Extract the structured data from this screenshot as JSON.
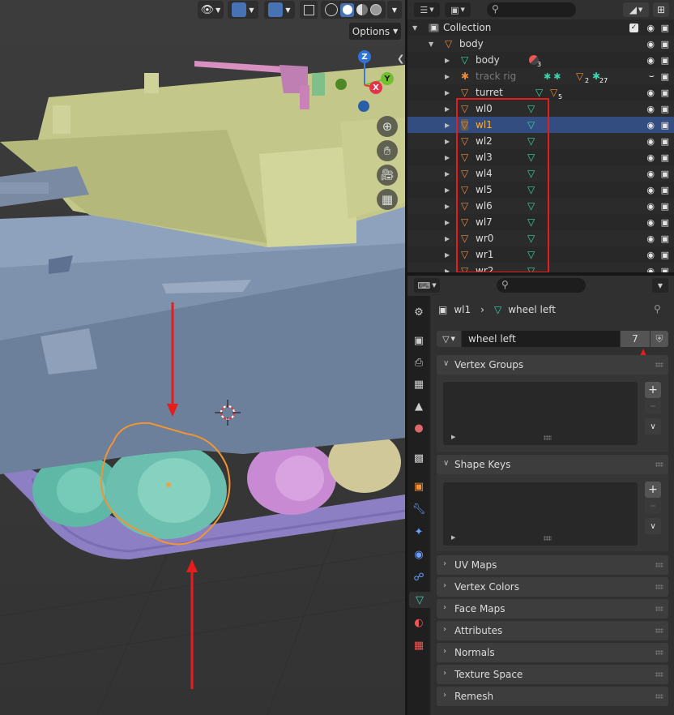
{
  "viewport": {
    "options_label": "Options",
    "gizmo": {
      "z": "Z",
      "y": "Y",
      "x": "X"
    }
  },
  "outliner": {
    "rows": [
      {
        "name": "Collection",
        "kind": "collection"
      },
      {
        "name": "body",
        "kind": "object"
      },
      {
        "name": "body",
        "kind": "mesh",
        "badge": "3"
      },
      {
        "name": "track rig",
        "kind": "armature",
        "badges": [
          "2",
          "27"
        ]
      },
      {
        "name": "turret",
        "kind": "object",
        "badge": "5"
      },
      {
        "name": "wl0",
        "kind": "object"
      },
      {
        "name": "wl1",
        "kind": "object"
      },
      {
        "name": "wl2",
        "kind": "object"
      },
      {
        "name": "wl3",
        "kind": "object"
      },
      {
        "name": "wl4",
        "kind": "object"
      },
      {
        "name": "wl5",
        "kind": "object"
      },
      {
        "name": "wl6",
        "kind": "object"
      },
      {
        "name": "wl7",
        "kind": "object"
      },
      {
        "name": "wr0",
        "kind": "object"
      },
      {
        "name": "wr1",
        "kind": "object"
      },
      {
        "name": "wr2",
        "kind": "object"
      }
    ]
  },
  "properties": {
    "breadcrumb": {
      "object": "wl1",
      "data": "wheel left"
    },
    "datablock": {
      "name": "wheel left",
      "users": "7"
    },
    "panels": {
      "vertex_groups": "Vertex Groups",
      "shape_keys": "Shape Keys",
      "uv_maps": "UV Maps",
      "vertex_colors": "Vertex Colors",
      "face_maps": "Face Maps",
      "attributes": "Attributes",
      "normals": "Normals",
      "texture_space": "Texture Space",
      "remesh": "Remesh"
    }
  },
  "colors": {
    "selection_active": "#ffaf29",
    "annotation": "#e51d1d",
    "mesh_data": "#3ad2a9",
    "object": "#e98a3c"
  }
}
